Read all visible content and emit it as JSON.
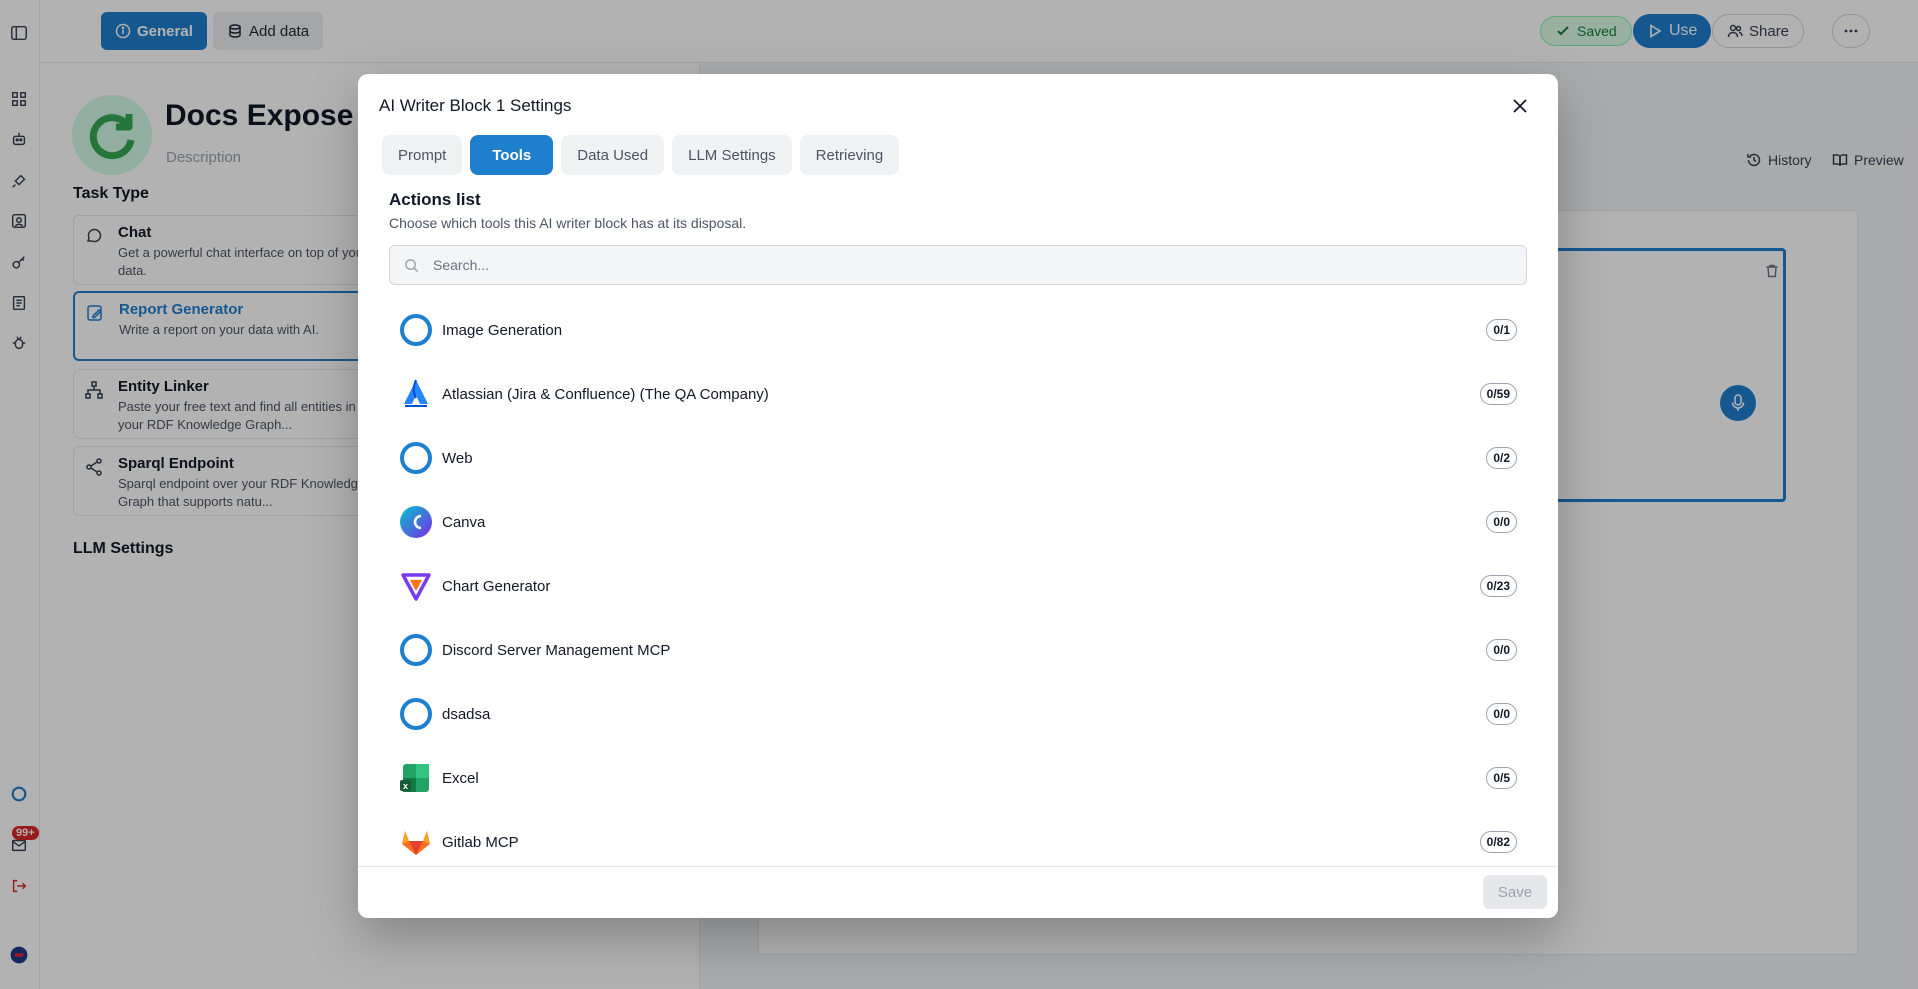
{
  "topbar": {
    "general_label": "General",
    "add_data_label": "Add data",
    "saved_label": "Saved",
    "use_label": "Use",
    "share_label": "Share"
  },
  "project": {
    "title": "Docs Expose S",
    "description_placeholder": "Description",
    "task_type_heading": "Task Type",
    "tasks": [
      {
        "title": "Chat",
        "desc": "Get a powerful chat interface on top of your data."
      },
      {
        "title": "Report Generator",
        "desc": "Write a report on your data with AI."
      },
      {
        "title": "Entity Linker",
        "desc": "Paste your free text and find all entities in your RDF Knowledge Graph..."
      },
      {
        "title": "Sparql Endpoint",
        "desc": "Sparql endpoint over your RDF Knowledge Graph that supports natu..."
      }
    ],
    "llm_settings_heading": "LLM Settings"
  },
  "right": {
    "history_label": "History",
    "preview_label": "Preview"
  },
  "notifications": {
    "badge": "99+"
  },
  "modal": {
    "title": "AI Writer Block 1 Settings",
    "tabs": [
      {
        "label": "Prompt"
      },
      {
        "label": "Tools"
      },
      {
        "label": "Data Used"
      },
      {
        "label": "LLM Settings"
      },
      {
        "label": "Retrieving"
      }
    ],
    "active_tab": "Tools",
    "actions_heading": "Actions list",
    "actions_subheading": "Choose which tools this AI writer block has at its disposal.",
    "search_placeholder": "Search...",
    "tools": [
      {
        "name": "Image Generation",
        "count": "0/1",
        "icon": "default-ring-icon"
      },
      {
        "name": "Atlassian (Jira & Confluence) (The QA Company)",
        "count": "0/59",
        "icon": "atlassian-icon"
      },
      {
        "name": "Web",
        "count": "0/2",
        "icon": "default-ring-icon"
      },
      {
        "name": "Canva",
        "count": "0/0",
        "icon": "canva-icon"
      },
      {
        "name": "Chart Generator",
        "count": "0/23",
        "icon": "chart-generator-icon"
      },
      {
        "name": "Discord Server Management MCP",
        "count": "0/0",
        "icon": "default-ring-icon"
      },
      {
        "name": "dsadsa",
        "count": "0/0",
        "icon": "default-ring-icon"
      },
      {
        "name": "Excel",
        "count": "0/5",
        "icon": "excel-icon"
      },
      {
        "name": "Gitlab MCP",
        "count": "0/82",
        "icon": "gitlab-icon"
      }
    ],
    "save_label": "Save"
  },
  "colors": {
    "accent": "#1f7fcf",
    "saved_green": "#15803d",
    "badge_red": "#dc2626"
  }
}
